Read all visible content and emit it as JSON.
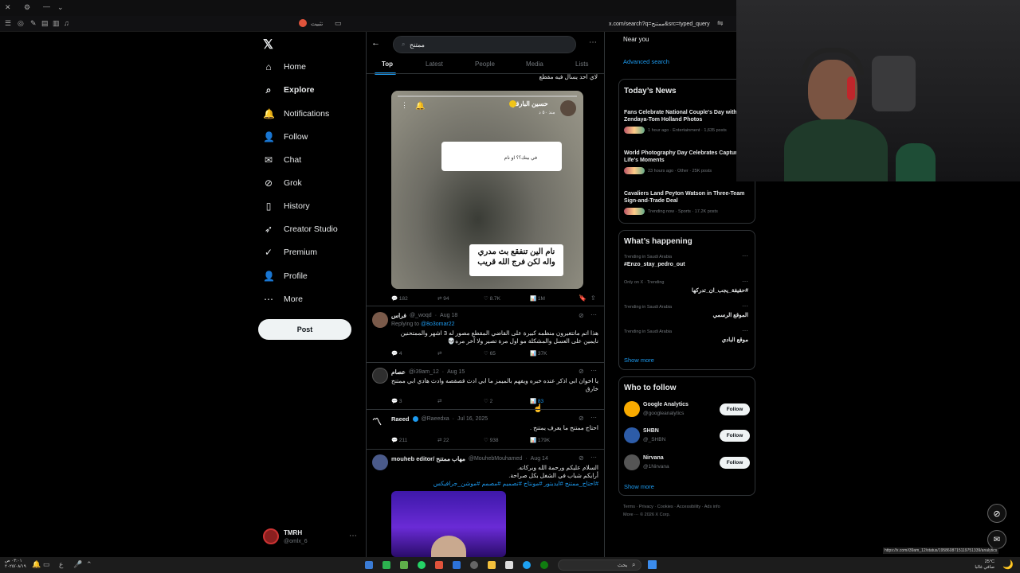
{
  "browser": {
    "tab_title": "تثبيت",
    "url": "x.com/search?q=ممتنح&src=typed_query",
    "status_url": "https://x.com/i39am_12/status/1958608715119751339/analytics"
  },
  "sidebar": {
    "items": [
      {
        "label": "Home",
        "icon": "⌂"
      },
      {
        "label": "Explore",
        "icon": "⌕"
      },
      {
        "label": "Notifications",
        "icon": "🔔"
      },
      {
        "label": "Follow",
        "icon": "👤"
      },
      {
        "label": "Chat",
        "icon": "✉"
      },
      {
        "label": "Grok",
        "icon": "⊘"
      },
      {
        "label": "History",
        "icon": "▯"
      },
      {
        "label": "Creator Studio",
        "icon": "➶"
      },
      {
        "label": "Premium",
        "icon": "✓"
      },
      {
        "label": "Profile",
        "icon": "👤"
      },
      {
        "label": "More",
        "icon": "⋯"
      }
    ],
    "post_label": "Post",
    "account": {
      "name": "TMRH",
      "handle": "@omlx_6"
    }
  },
  "search": {
    "query": "ممتنح",
    "tabs": [
      "Top",
      "Latest",
      "People",
      "Media",
      "Lists"
    ]
  },
  "tweets": {
    "top_snippet": "لاي احد يسال فيه مقطع",
    "image_post": {
      "author": "حسين البارقي",
      "time": "منذ ٥٠ د",
      "question": "في بيتك؟؟ او نام",
      "caption": "نام الين تنفقع بث مدري واله لكن فرج الله قريب",
      "stats": {
        "replies": "182",
        "reposts": "94",
        "likes": "8.7K",
        "views": "1M"
      }
    },
    "t1": {
      "name": "فراس",
      "handle": "@_woqd",
      "date": "Aug 18",
      "reply_to_prefix": "Replying to",
      "reply_to": "@8o3omar22",
      "text1": "هذا اتم ماتتغيرون منظمه كبيرة على القاضي المقطع مصور له 3 اشهر والممتحنين",
      "text2": "نايمين على العسل والمشكلة مو اول مرة تصير ولا آخر مره💀",
      "stats": {
        "replies": "4",
        "reposts": "",
        "likes": "65",
        "views": "37K"
      }
    },
    "t2": {
      "name": "عصام",
      "handle": "@i39am_12",
      "date": "Aug 15",
      "text1": "يا اخوان ابي اذكر عنده خبره ويفهم بالميمز ما ابي ادث قصقصه وادث هادي ابي ممتنح",
      "text2": "خارق",
      "stats": {
        "replies": "3",
        "reposts": "",
        "likes": "2",
        "views": "83"
      }
    },
    "t3": {
      "name": "Raeed",
      "handle": "@Raeedxa",
      "date": "Jul 16, 2025",
      "text1": "احتاج ممتنح ما يعرف يمتنح .",
      "stats": {
        "replies": "211",
        "reposts": "22",
        "likes": "938",
        "views": "179K"
      }
    },
    "t4": {
      "name": "mouheb editor/ مهاب ممتنح",
      "handle": "@MouhebMouhamed",
      "date": "Aug 14",
      "text1": "السلام عليكم ورحمة الله وبركاته.",
      "text2": "أرايكم شباب في الشغل بكل صراحة.",
      "text3": "#احتاج_ممتنح #ايديتور #مونتاج #تصميم #مصمم #موشن_جرافيكس"
    }
  },
  "right": {
    "location": "Near you",
    "advanced": "Advanced search",
    "news_title": "Today’s News",
    "news": [
      {
        "title": "Fans Celebrate National Couple's Day with Zendaya-Tom Holland Photos",
        "meta": "1 hour ago · Entertainment · 1,635 posts"
      },
      {
        "title": "World Photography Day Celebrates Capturing Life's Moments",
        "meta": "23 hours ago · Other · 25K posts"
      },
      {
        "title": "Cavaliers Land Peyton Watson in Three-Team Sign-and-Trade Deal",
        "meta": "Trending now · Sports · 17.2K posts"
      }
    ],
    "happening_title": "What’s happening",
    "trends": [
      {
        "context": "Trending in Saudi Arabia",
        "name": "#Enzo_stay_pedro_out"
      },
      {
        "context": "Only on X · Trending",
        "name": "#حقيقة_يجب_ان_تدركها"
      },
      {
        "context": "Trending in Saudi Arabia",
        "name": "الموقع الرسمي"
      },
      {
        "context": "Trending in Saudi Arabia",
        "name": "موقع البادي"
      }
    ],
    "show_more": "Show more",
    "wtf_title": "Who to follow",
    "wtf": [
      {
        "name": "Google Analytics",
        "handle": "@googleanalytics"
      },
      {
        "name": "SHBN",
        "handle": "@_SHBN"
      },
      {
        "name": "Nirvana",
        "handle": "@1Nirvana"
      }
    ],
    "follow_label": "Follow",
    "footer1": "Terms · Privacy · Cookies · Accessibility · Ads info",
    "footer2": "More ··· © 2026 X Corp."
  },
  "taskbar": {
    "search": "بحث",
    "weather": "25°C",
    "weather_sub": "صافي غالبا",
    "time": "٠٣:٠١ ص",
    "date": "٢٠٢٥/٠٨/١٩"
  },
  "colors": {
    "accent": "#1d9bf0",
    "bg": "#000000",
    "border": "#2f3336",
    "muted": "#71767b"
  }
}
